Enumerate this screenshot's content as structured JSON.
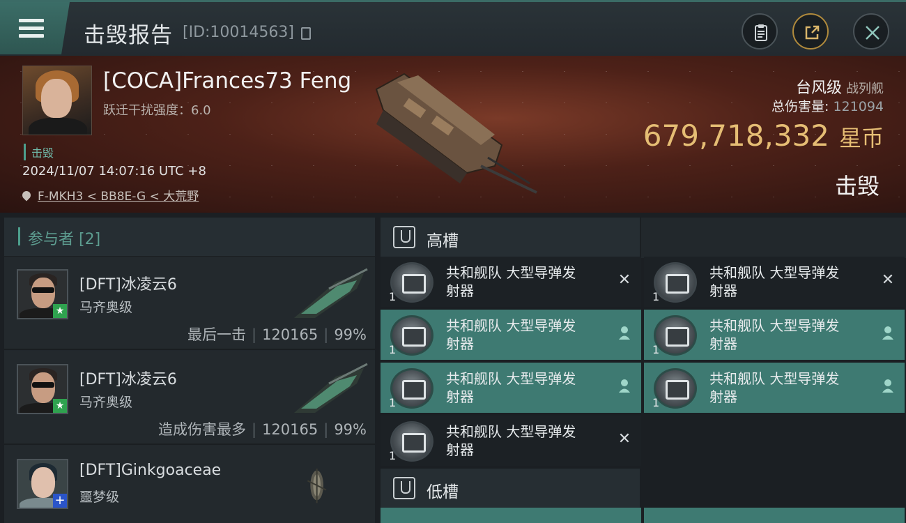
{
  "header": {
    "title": "击毁报告",
    "report_id": "[ID:10014563]"
  },
  "victim": {
    "name": "[COCA]Frances73 Feng",
    "warp_disruption": "跃迁干扰强度：6.0",
    "status": "击毁",
    "time": "2024/11/07 14:07:16 UTC +8",
    "location": "F-MKH3 < BB8E-G < 大荒野",
    "ship_name": "台风级",
    "ship_type": "战列舰",
    "total_damage_label": "总伤害量:",
    "total_damage": "121094",
    "isk_value": "679,718,332",
    "isk_unit": "星币",
    "result": "击毁"
  },
  "participants": {
    "label": "参与者 [2]",
    "rows": [
      {
        "name": "[DFT]冰凌云6",
        "ship": "马齐奥级",
        "role": "最后一击",
        "damage": "120165",
        "percent": "99%",
        "badge": "★"
      },
      {
        "name": "[DFT]冰凌云6",
        "ship": "马齐奥级",
        "role": "造成伤害最多",
        "damage": "120165",
        "percent": "99%",
        "badge": "★"
      },
      {
        "name": "[DFT]Ginkgoaceae",
        "ship": "噩梦级",
        "badge": "+"
      }
    ]
  },
  "slots": {
    "high_label": "高槽",
    "low_label": "低槽",
    "modules": [
      {
        "line1": "共和舰队 大型导弹发",
        "line2": "射器",
        "qty": "1",
        "state": "destroyed"
      },
      {
        "line1": "共和舰队 大型导弹发",
        "line2": "射器",
        "qty": "1",
        "state": "destroyed"
      },
      {
        "line1": "共和舰队 大型导弹发",
        "line2": "射器",
        "qty": "1",
        "state": "dropped"
      },
      {
        "line1": "共和舰队 大型导弹发",
        "line2": "射器",
        "qty": "1",
        "state": "dropped"
      },
      {
        "line1": "共和舰队 大型导弹发",
        "line2": "射器",
        "qty": "1",
        "state": "dropped"
      },
      {
        "line1": "共和舰队 大型导弹发",
        "line2": "射器",
        "qty": "1",
        "state": "dropped"
      },
      {
        "line1": "共和舰队 大型导弹发",
        "line2": "射器",
        "qty": "1",
        "state": "destroyed"
      }
    ]
  },
  "icons": {
    "menu": "hamburger-menu-icon",
    "copy": "copy-icon",
    "clipboard": "clipboard-icon",
    "share": "share-icon",
    "close": "close-icon",
    "location": "location-pin-icon",
    "slot": "slot-icon",
    "destroyed": "x-mark-icon",
    "dropped": "person-icon"
  },
  "colors": {
    "accent": "#4d9f8d",
    "fitted_module": "#3e7a72",
    "isk": "#e5bd74"
  }
}
